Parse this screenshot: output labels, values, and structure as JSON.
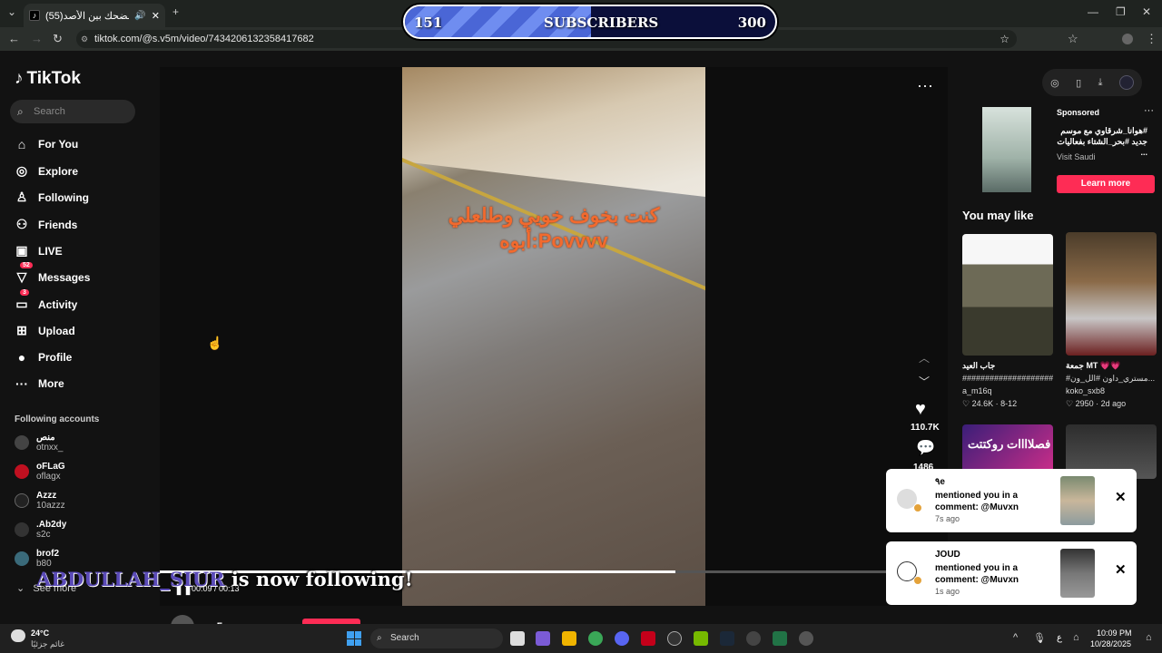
{
  "browser": {
    "tab_title": "(55)تفاعل مضحك بين الأصد",
    "tab_icon": "tiktok-icon",
    "url": "tiktok.com/@s.v5m/video/7434206132358417682"
  },
  "overlay": {
    "sub_current": "151",
    "sub_label": "SUBSCRIBERS",
    "sub_goal": "300",
    "progress": 0.503,
    "follow_name": "ABDULLAH_SIUR",
    "follow_text": "is now following!"
  },
  "sidebar": {
    "logo": "TikTok",
    "search_placeholder": "Search",
    "items": [
      {
        "label": "For You",
        "icon": "home-icon"
      },
      {
        "label": "Explore",
        "icon": "compass-icon"
      },
      {
        "label": "Following",
        "icon": "following-icon"
      },
      {
        "label": "Friends",
        "icon": "friends-icon"
      },
      {
        "label": "LIVE",
        "icon": "live-icon"
      },
      {
        "label": "Messages",
        "icon": "messages-icon",
        "badge": "52"
      },
      {
        "label": "Activity",
        "icon": "activity-icon",
        "badge": "3"
      },
      {
        "label": "Upload",
        "icon": "upload-icon"
      },
      {
        "label": "Profile",
        "icon": "profile-icon"
      },
      {
        "label": "More",
        "icon": "more-icon"
      }
    ],
    "following_title": "Following accounts",
    "accounts": [
      {
        "name": "منص",
        "user": "otnxx_"
      },
      {
        "name": "oFLaG",
        "user": "oflagx"
      },
      {
        "name": "Azzz",
        "user": "10azzz"
      },
      {
        "name": ".Ab2dy",
        "user": "s2c"
      },
      {
        "name": "brof2",
        "user": "b80"
      }
    ],
    "see_more": "See more"
  },
  "video": {
    "caption_line1": "كنت بخوف خويي وطلعلي",
    "caption_line2": "أبوه:Povvvv",
    "like_count": "110.7K",
    "comment_count": "1486",
    "time": "00:09 / 00:13",
    "author": "s.v5m",
    "progress": 0.71
  },
  "right": {
    "ad_sponsored": "Sponsored",
    "ad_text": "#هوانا_شرقاوي مع موسم جديد #بحر_الشتاء بفعاليات ...",
    "ad_brand": "Visit Saudi",
    "learn_more": "Learn more",
    "you_may_like": "You may like",
    "cards": [
      {
        "title": "جاب العيد",
        "sub": "######################",
        "user": "a_m16q",
        "likes": "24.6K",
        "date": "8-12"
      },
      {
        "title": "جمعة MT 💗💗",
        "sub": "#مستري_داون #الل_ون...",
        "user": "koko_sxb8",
        "likes": "2950",
        "date": "2d ago"
      },
      {
        "text": "فصلاااات روكتتت"
      }
    ]
  },
  "notifications": [
    {
      "name": "٩e",
      "msg": "mentioned you in a comment: @Muvxn",
      "time": "7s ago"
    },
    {
      "name": "JOUD",
      "msg": "mentioned you in a comment: @Muvxn",
      "time": "1s ago"
    }
  ],
  "taskbar": {
    "weather_temp": "24°C",
    "weather_desc": "غائم جزئيًا",
    "search": "Search",
    "lang": "ع",
    "time": "10:09 PM",
    "date": "10/28/2025"
  }
}
